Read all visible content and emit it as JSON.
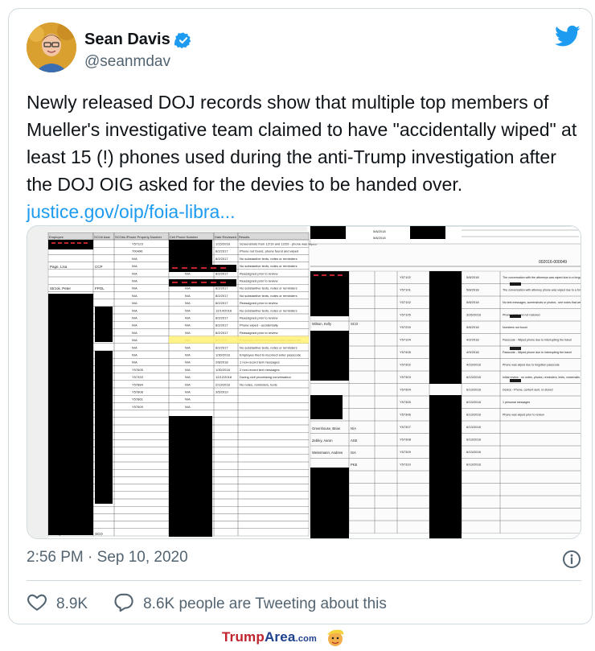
{
  "author": {
    "name": "Sean Davis",
    "handle": "@seanmdav",
    "avatar_icon": "avatar-photo",
    "verified_icon": "verified-badge-icon"
  },
  "platform_icon": "twitter-bird-icon",
  "tweet": {
    "text": "Newly released DOJ records show that multiple top members of Mueller's investigative team claimed to have \"accidentally wiped\" at least 15 (!) phones used during the anti-Trump investigation after the DOJ OIG asked for the devies to be handed over.",
    "link_text": "justice.gov/oip/foia-libra..."
  },
  "media": {
    "left_doc": {
      "header_cols": [
        "Employee",
        "SCO# Asst",
        "SCO#s iPhone Property Number",
        "Cell Phone Number",
        "Date Reviewed",
        "Results"
      ],
      "names": [
        "Page, Lisa",
        "Strzok, Peter",
        "Zebley, Aaron"
      ],
      "asst_codes": [
        "CCP",
        "FPOL",
        "SCO"
      ],
      "property_numbers": [
        "Y57123",
        "700496",
        "N/A",
        "N/A",
        "N/A",
        "N/A",
        "N/A",
        "N/A",
        "N/A",
        "N/A",
        "N/A",
        "N/A",
        "N/A",
        "N/A",
        "N/A",
        "N/A",
        "N/A",
        "Y57605",
        "Y57333",
        "Y57884",
        "Y57808",
        "Y57861",
        "Y57609"
      ],
      "phone_values": [
        "N/A",
        "N/A",
        "N/A",
        "N/A",
        "N/A",
        "N/A",
        "N/A",
        "N/A",
        "N/A",
        "N/A",
        "N/A",
        "N/A",
        "N/A",
        "N/A",
        "N/A",
        "N/A",
        "N/A",
        "N/A",
        "N/A",
        "N/A",
        "N/A",
        "N/A",
        "N/A"
      ],
      "dates": [
        "1/15/2018",
        "8/2/2017",
        "8/2/2017",
        "8/2/2017",
        "8/2/2017",
        "8/2/2017",
        "8/2/2017",
        "8/2/2017",
        "8/2/2017",
        "12/14/2018",
        "8/2/2017",
        "8/2/2017",
        "8/2/2017",
        "8/2/2017",
        "8/2/2017",
        "1/30/2018",
        "2/8/2018",
        "1/30/2018",
        "12/12/2018",
        "2/13/2018",
        "3/5/2019"
      ],
      "results": [
        "Screenshots from 12/19 and 12/29 - phone was wiped",
        "Phone not found, phone found and wiped",
        "No substantive texts, notes or reminders",
        "No substantive texts, notes or reminders",
        "Reassigned prior to review",
        "Reassigned prior to review",
        "No substantive texts, notes or reminders",
        "No substantive texts, notes or reminders",
        "Reassigned prior to review",
        "No substantive texts, notes or reminders",
        "Reassigned prior to review",
        "Phone wiped - accidentally",
        "Reassigned prior to review",
        "Employee tried to incorrect enter passcode",
        "No substantive texts, notes or reminders",
        "Employee tried to incorrect enter passcode",
        "1 non-record text messages",
        "2 non-record text messages",
        "During civil processing conversation",
        "No notes, reminders, texts"
      ]
    },
    "right_doc": {
      "top_dates": [
        "5/8/2018",
        "5/8/2018"
      ],
      "page_id": "002016-000049",
      "names": [
        "Wilson, Kelly",
        "Greenhouse, Brian",
        "Zebley, Aaron",
        "Weissmann, Andrew"
      ],
      "codes": [
        "SCO",
        "N/A",
        "ASE",
        "ISA",
        "PKE"
      ],
      "ids": [
        "Y57102",
        "Y57101",
        "Y57102",
        "Y57105",
        "Y57200",
        "Y57104",
        "Y57405",
        "Y57302",
        "Y57303",
        "Y57304",
        "Y57305",
        "Y57306",
        "Y57307",
        "Y57308",
        "Y57309",
        "Y57310"
      ],
      "dates": [
        "5/8/2018",
        "5/8/2018",
        "5/8/2018",
        "3/26/2018",
        "5/8/2018",
        "4/2/2018",
        "4/9/2018",
        "4/23/2018",
        "6/13/2018",
        "6/13/2018",
        "6/13/2018",
        "6/13/2018",
        "6/13/2018",
        "6/13/2018",
        "6/13/2018",
        "6/13/2018"
      ],
      "results": [
        "The conversation with the attorneys was wiped due to a forgotten passcode",
        "The conversation with attorney phone was wiped due to a forgotten passcode",
        "No text messages, screenshots or photos - see notes that were synced",
        "Phone reset and not restored",
        "Numbers not found",
        "Passcode - Wiped phone due to interrupting the travel",
        "Passcode - Wiped phone due to interrupting the travel",
        "Phone was wiped due to forgotten passcode",
        "Initial review - no notes, photos, reminders, texts, voicemails",
        "Device - Phone, content sent, re-stored",
        "1 personal messages",
        "Phone was wiped prior to review"
      ]
    }
  },
  "timestamp": "2:56 PM · Sep 10, 2020",
  "info_icon": "info-circle-icon",
  "actions": {
    "like_icon": "heart-icon",
    "like_count": "8.9K",
    "reply_icon": "speech-bubble-icon",
    "reply_text": "8.6K people are Tweeting about this"
  },
  "watermark": {
    "brand_part1": "Trump",
    "brand_part2": "Area",
    "brand_suffix": ".com",
    "mascot_icon": "trump-mascot-icon"
  },
  "colors": {
    "link": "#1d9bf0",
    "text_primary": "#0f1419",
    "text_secondary": "#536471",
    "border": "#cfd9de",
    "redaction": "#000000",
    "watermark_red": "#c0232e",
    "watermark_blue": "#1f3f8f"
  }
}
